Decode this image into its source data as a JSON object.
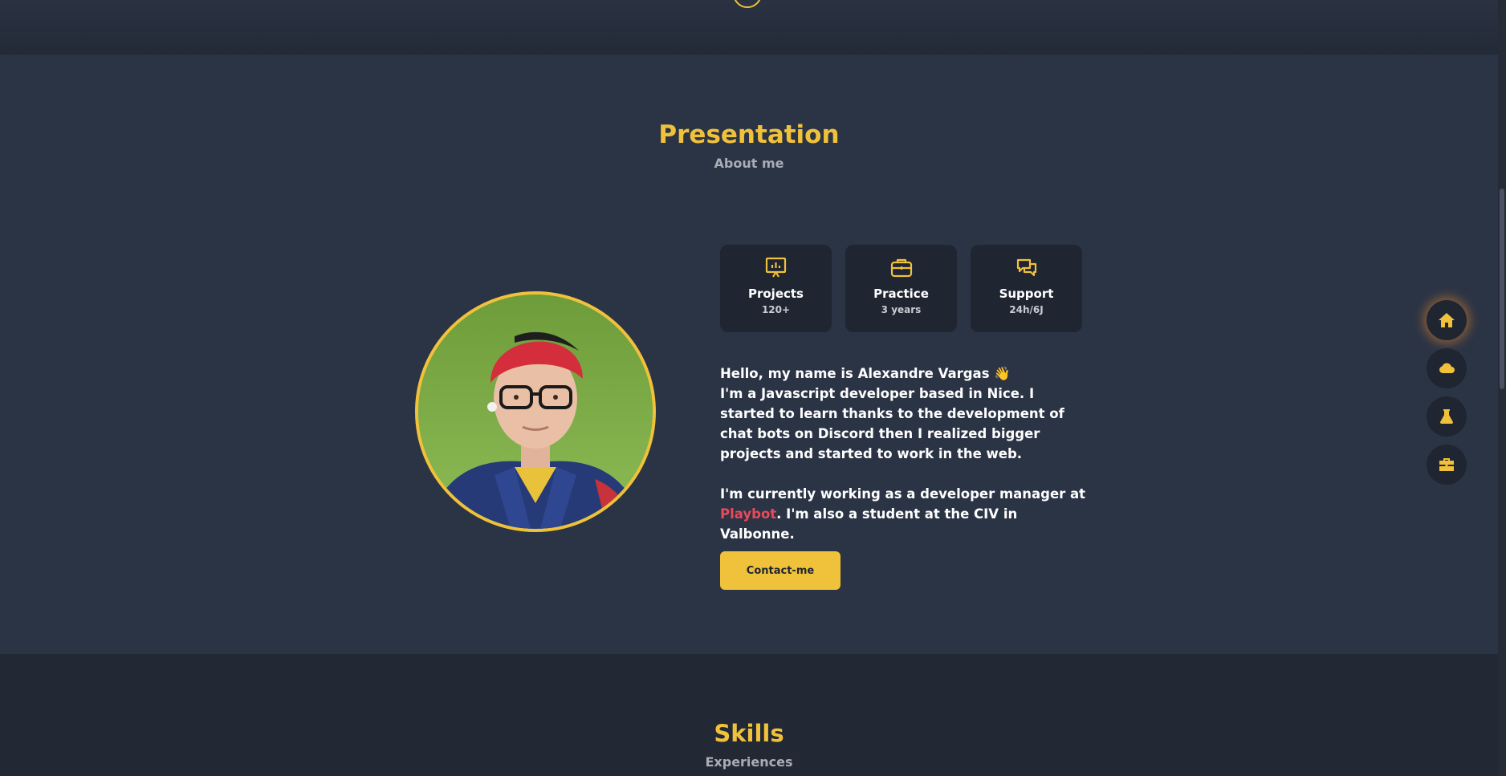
{
  "presentation": {
    "title": "Presentation",
    "subtitle": "About me",
    "stats": [
      {
        "label": "Projects",
        "value": "120+",
        "icon": "presentation-board-icon"
      },
      {
        "label": "Practice",
        "value": "3 years",
        "icon": "briefcase-icon"
      },
      {
        "label": "Support",
        "value": "24h/6J",
        "icon": "chat-bubbles-icon"
      }
    ],
    "greeting": "Hello, my name is Alexandre Vargas 👋",
    "intro": "I'm a Javascript developer based in Nice. I started to learn thanks to the development of chat bots on Discord then I realized bigger projects and started to work in the web.",
    "current_prefix": "I'm currently working as a developer manager at",
    "company": "Playbot",
    "current_suffix": ". I'm also a student at the CIV in Valbonne.",
    "contact_label": "Contact-me"
  },
  "skills": {
    "title": "Skills",
    "subtitle": "Experiences"
  },
  "side_nav": [
    {
      "icon": "home-icon",
      "active": true
    },
    {
      "icon": "cloud-icon",
      "active": false
    },
    {
      "icon": "flask-icon",
      "active": false
    },
    {
      "icon": "toolbox-icon",
      "active": false
    }
  ],
  "colors": {
    "accent": "#f0c13a",
    "highlight": "#e84a5a",
    "background": "#2b3445",
    "card": "#1f2531"
  }
}
